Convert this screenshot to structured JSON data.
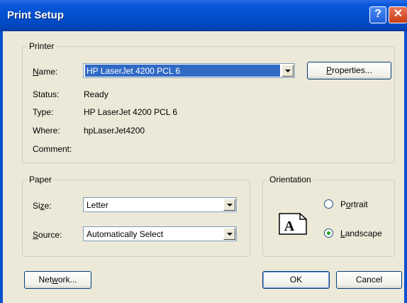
{
  "window": {
    "title": "Print Setup",
    "help_glyph": "?",
    "close_glyph": "✕"
  },
  "printer": {
    "group_label": "Printer",
    "name_label_u": "N",
    "name_label_rest": "ame:",
    "name_value": "HP LaserJet 4200 PCL 6",
    "properties_u": "P",
    "properties_rest": "roperties...",
    "status_label": "Status:",
    "status_value": "Ready",
    "type_label": "Type:",
    "type_value": "HP LaserJet 4200 PCL 6",
    "where_label": "Where:",
    "where_value": "hpLaserJet4200",
    "comment_label": "Comment:"
  },
  "paper": {
    "group_label": "Paper",
    "size_label_pre": "Si",
    "size_label_u": "z",
    "size_label_post": "e:",
    "size_value": "Letter",
    "source_label_u": "S",
    "source_label_rest": "ource:",
    "source_value": "Automatically Select"
  },
  "orientation": {
    "group_label": "Orientation",
    "portrait_pre": "P",
    "portrait_u": "o",
    "portrait_post": "rtrait",
    "landscape_u": "L",
    "landscape_rest": "andscape",
    "selected": "landscape",
    "icon_letter": "A"
  },
  "buttons": {
    "network_pre": "Net",
    "network_u": "w",
    "network_post": "ork...",
    "ok": "OK",
    "cancel": "Cancel"
  }
}
